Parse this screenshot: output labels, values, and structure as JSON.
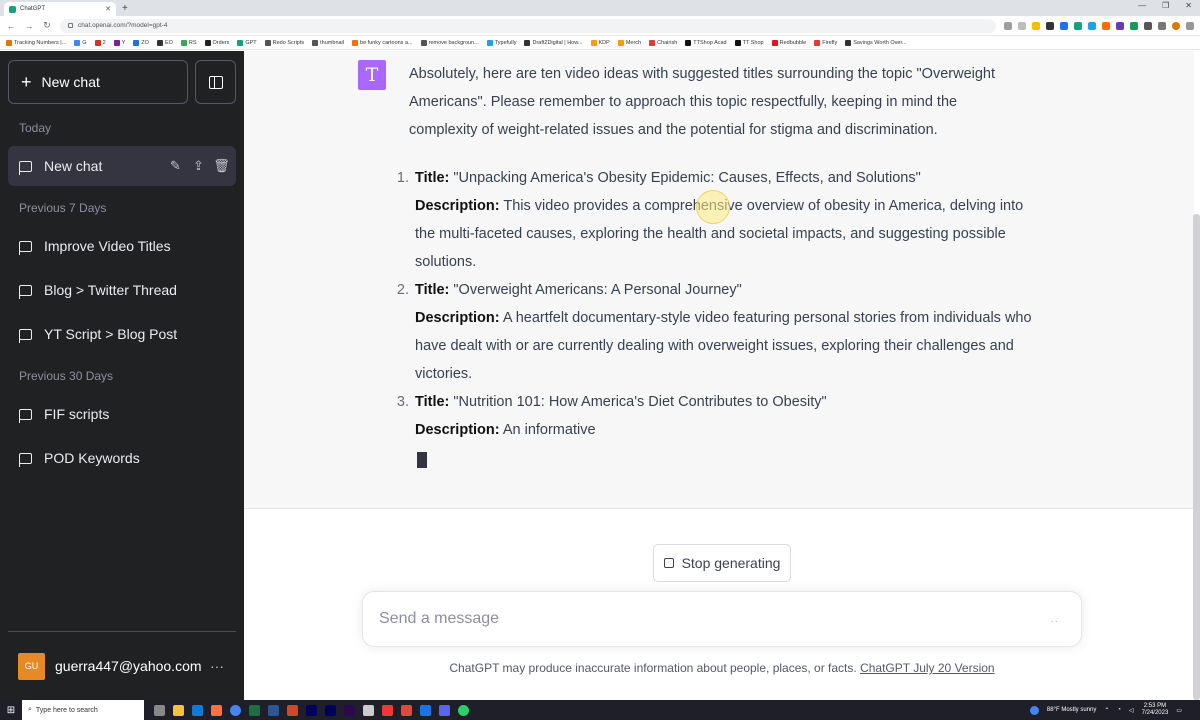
{
  "browser": {
    "tab_title": "ChatGPT",
    "url": "chat.openai.com/?model=gpt-4",
    "bookmarks": [
      {
        "label": "Tracking Numbers |...",
        "color": "#e37400"
      },
      {
        "label": "G",
        "color": "#4285f4"
      },
      {
        "label": "2",
        "color": "#d93025"
      },
      {
        "label": "Y",
        "color": "#7b1fa2"
      },
      {
        "label": "ZO",
        "color": "#1a73e8"
      },
      {
        "label": "EO",
        "color": "#333333"
      },
      {
        "label": "RS",
        "color": "#34a853"
      },
      {
        "label": "Orders",
        "color": "#222222"
      },
      {
        "label": "GPT",
        "color": "#10a37f"
      },
      {
        "label": "Redo Scripts",
        "color": "#555555"
      },
      {
        "label": "thumbnail",
        "color": "#555555"
      },
      {
        "label": "be funky cartoons a...",
        "color": "#ff6d00"
      },
      {
        "label": "remove backgroun...",
        "color": "#555555"
      },
      {
        "label": "Typefully",
        "color": "#1da1f2"
      },
      {
        "label": "Draft2Digital | How...",
        "color": "#333333"
      },
      {
        "label": "KDP",
        "color": "#ff9900"
      },
      {
        "label": "Merch",
        "color": "#ff9900"
      },
      {
        "label": "Chairish",
        "color": "#e53935"
      },
      {
        "label": "TTShop Acad",
        "color": "#111111"
      },
      {
        "label": "TT Shop",
        "color": "#111111"
      },
      {
        "label": "Redbubble",
        "color": "#e41321"
      },
      {
        "label": "Firefly",
        "color": "#e53935"
      },
      {
        "label": "Savings Worth Over...",
        "color": "#333333"
      }
    ]
  },
  "sidebar": {
    "new_chat_label": "New chat",
    "sections": {
      "today": "Today",
      "prev7": "Previous 7 Days",
      "prev30": "Previous 30 Days"
    },
    "items": [
      {
        "label": "New chat"
      },
      {
        "label": "Improve Video Titles"
      },
      {
        "label": "Blog > Twitter Thread"
      },
      {
        "label": "YT Script > Blog Post"
      },
      {
        "label": "FIF scripts"
      },
      {
        "label": "POD Keywords"
      }
    ],
    "account": {
      "initials": "GU",
      "email": "guerra447@yahoo.com",
      "menu": "···"
    }
  },
  "assistant": {
    "avatar_letter": "T",
    "intro": "Absolutely, here are ten video ideas with suggested titles surrounding the topic \"Overweight Americans\". Please remember to approach this topic respectfully, keeping in mind the complexity of weight-related issues and the potential for stigma and discrimination.",
    "title_label": "Title:",
    "desc_label": "Description:",
    "items": [
      {
        "num": "1.",
        "title": "\"Unpacking America's Obesity Epidemic: Causes, Effects, and Solutions\"",
        "description": "This video provides a comprehensive overview of obesity in America, delving into the multi-faceted causes, exploring the health and societal impacts, and suggesting possible solutions."
      },
      {
        "num": "2.",
        "title": "\"Overweight Americans: A Personal Journey\"",
        "description": "A heartfelt documentary-style video featuring personal stories from individuals who have dealt with or are currently dealing with overweight issues, exploring their challenges and victories."
      },
      {
        "num": "3.",
        "title": "\"Nutrition 101: How America's Diet Contributes to Obesity\"",
        "description": "An informative"
      }
    ]
  },
  "composer": {
    "stop_label": "Stop generating",
    "placeholder": "Send a message",
    "footer_text": "ChatGPT may produce inaccurate information about people, places, or facts.",
    "footer_link": "ChatGPT July 20 Version"
  },
  "taskbar": {
    "search_placeholder": "Type here to search",
    "weather": "88°F  Mostly sunny",
    "time": "2:53 PM",
    "date": "7/24/2023"
  }
}
